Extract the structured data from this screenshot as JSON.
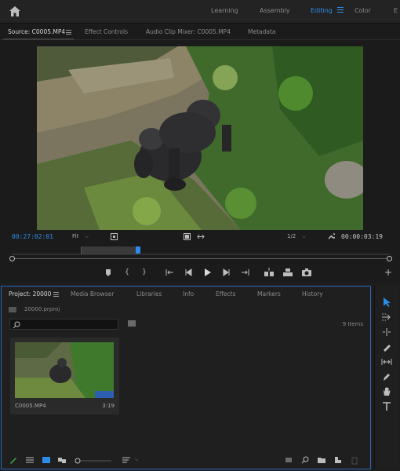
{
  "workspace": {
    "tabs": [
      {
        "label": "Learning"
      },
      {
        "label": "Assembly"
      },
      {
        "label": "Editing"
      },
      {
        "label": "Color"
      },
      {
        "label": "E"
      }
    ],
    "active_tab": "Editing"
  },
  "source_panel": {
    "tabs": [
      {
        "label": "Source: C0005.MP4"
      },
      {
        "label": "Effect Controls"
      },
      {
        "label": "Audio Clip Mixer: C0005.MP4"
      },
      {
        "label": "Metadata"
      }
    ],
    "playhead_timecode": "00:27:02:01",
    "zoom": "Fit",
    "resolution": "1/2",
    "duration_timecode": "00:00:03:19"
  },
  "project_panel": {
    "tabs": [
      {
        "label": "Project: 20000"
      },
      {
        "label": "Media Browser"
      },
      {
        "label": "Libraries"
      },
      {
        "label": "Info"
      },
      {
        "label": "Effects"
      },
      {
        "label": "Markers"
      },
      {
        "label": "History"
      }
    ],
    "project_file": "20000.prproj",
    "search_placeholder": "",
    "item_count": "9 Items",
    "clips": [
      {
        "name": "C0005.MP4",
        "duration": "3:19"
      }
    ]
  },
  "colors": {
    "accent": "#2d8ceb",
    "panel_bg": "#1b1b1b",
    "focus_border": "#2d6ab8"
  }
}
